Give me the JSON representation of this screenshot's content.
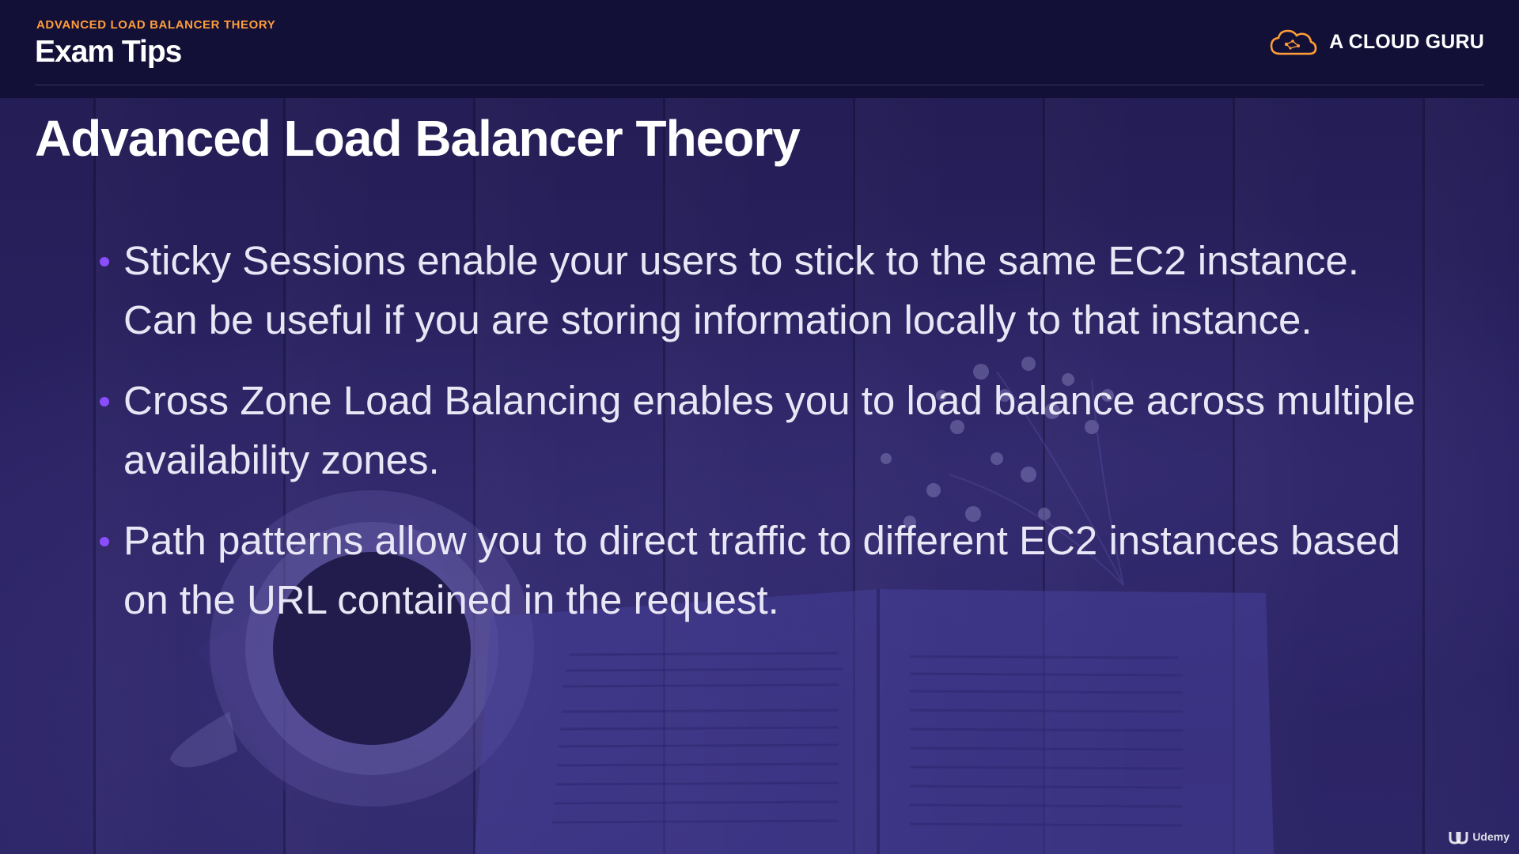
{
  "header": {
    "section_label": "ADVANCED LOAD BALANCER THEORY",
    "title": "Exam Tips",
    "brand_name": "A CLOUD GURU",
    "brand_icon": "cloud-logo-icon",
    "brand_color": "#ff9d3a"
  },
  "slide": {
    "title": "Advanced Load Balancer Theory",
    "bullets": [
      {
        "text": "Sticky Sessions enable your users to stick to the same EC2 instance. Can be useful if you are storing information locally to that instance."
      },
      {
        "text": "Cross Zone Load Balancing enables you to load balance across multiple availability zones."
      },
      {
        "text": "Path patterns allow you to direct traffic to different EC2 instances based on the URL contained in the request."
      }
    ],
    "bullet_color": "#8a4dff"
  },
  "watermark": {
    "label": "Udemy",
    "icon": "udemy-logo-icon"
  }
}
